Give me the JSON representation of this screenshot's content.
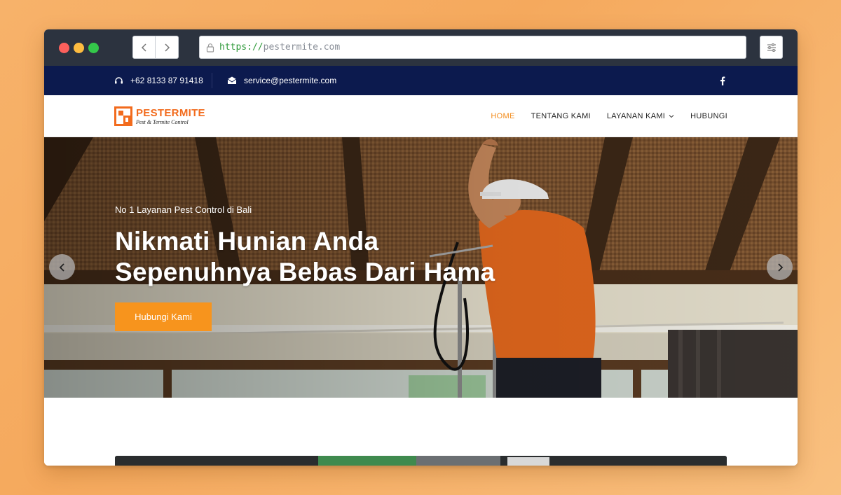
{
  "browser": {
    "url_scheme": "https://",
    "url_host": "pestermite.com"
  },
  "topbar": {
    "phone": "+62 8133 87 91418",
    "email": "service@pestermite.com"
  },
  "logo": {
    "name": "PESTERMITE",
    "tagline": "Pest & Termite Control"
  },
  "nav": {
    "items": [
      {
        "label": "HOME",
        "active": true
      },
      {
        "label": "TENTANG KAMI",
        "active": false
      },
      {
        "label": "LAYANAN KAMI",
        "active": false,
        "dropdown": true
      },
      {
        "label": "HUBUNGI",
        "active": false
      }
    ]
  },
  "hero": {
    "subtitle": "No 1 Layanan Pest Control di Bali",
    "title_line1": "Nikmati Hunian Anda",
    "title_line2": "Sepenuhnya Bebas Dari Hama",
    "cta": "Hubungi Kami"
  },
  "colors": {
    "accent": "#f7941d",
    "topbar": "#0c1a4e",
    "chrome": "#2c333f"
  }
}
